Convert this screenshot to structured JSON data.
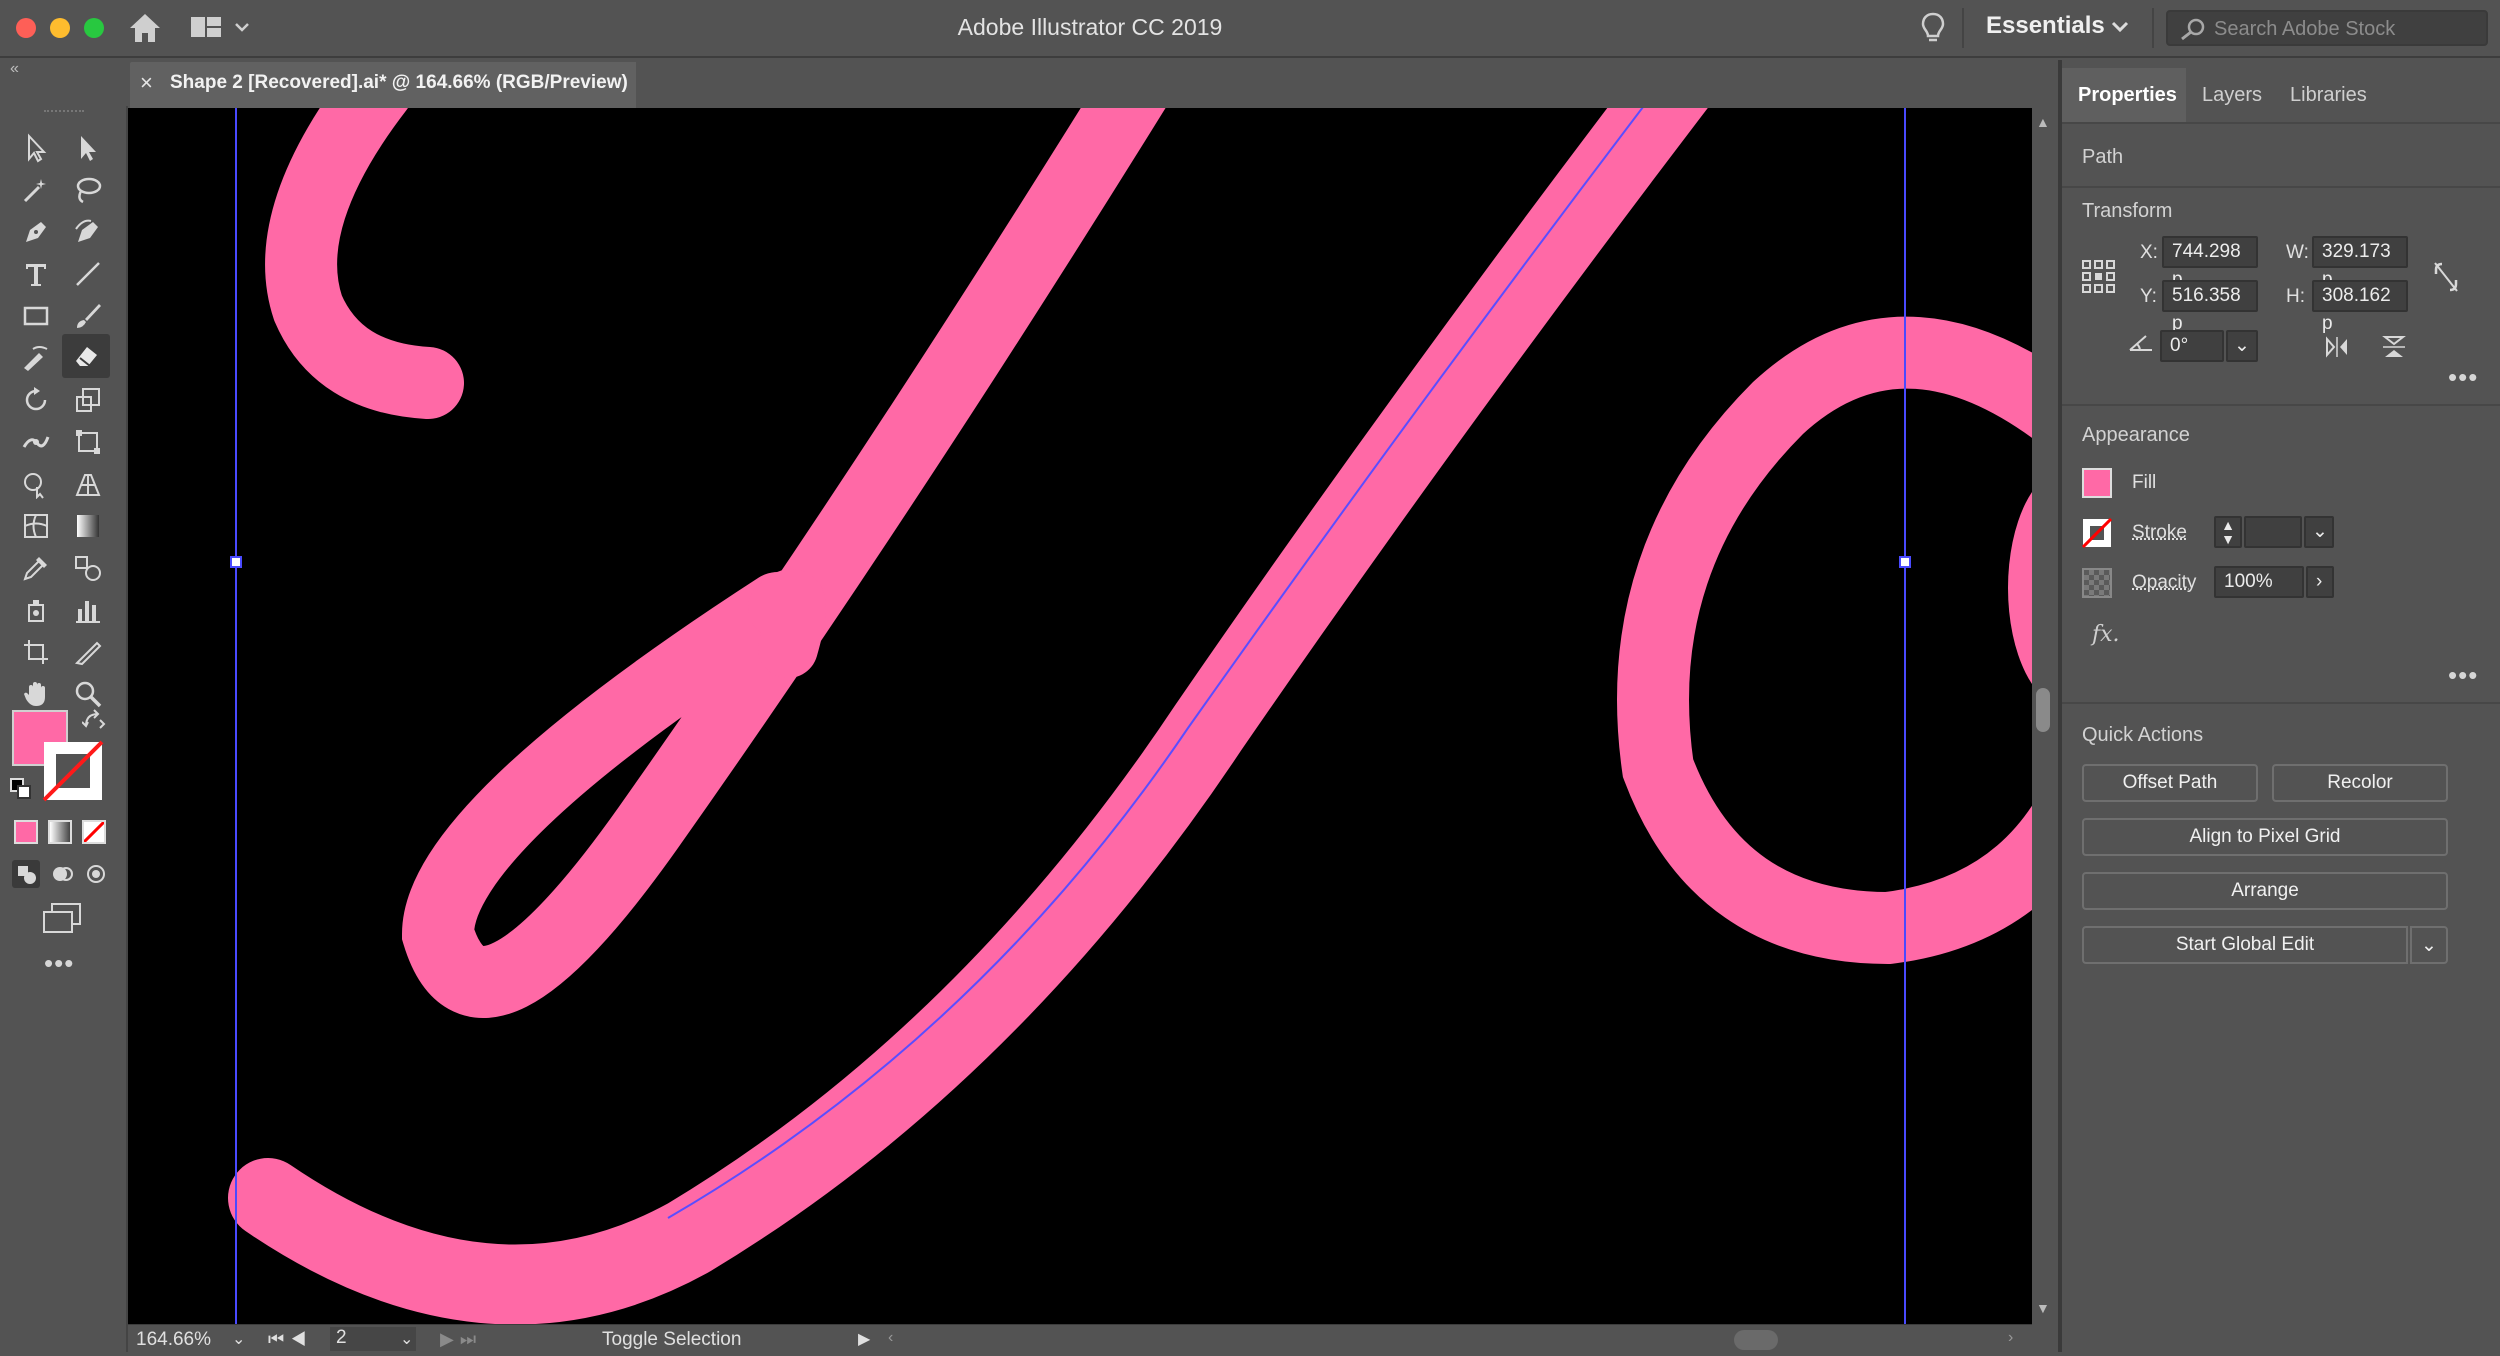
{
  "window": {
    "title": "Adobe Illustrator CC 2019",
    "workspace": "Essentials",
    "search_placeholder": "Search Adobe Stock"
  },
  "document_tab": {
    "label": "Shape 2 [Recovered].ai* @ 164.66% (RGB/Preview)",
    "close": "×"
  },
  "colors": {
    "fill": "#ff69a6",
    "canvas_bg": "#000000",
    "selection": "#4a4aff"
  },
  "panel": {
    "tabs": [
      "Properties",
      "Layers",
      "Libraries"
    ],
    "object_type": "Path",
    "transform": {
      "title": "Transform",
      "x_label": "X:",
      "x": "744.298 p",
      "y_label": "Y:",
      "y": "516.358 p",
      "w_label": "W:",
      "w": "329.173 p",
      "h_label": "H:",
      "h": "308.162 p",
      "angle": "0°"
    },
    "appearance": {
      "title": "Appearance",
      "fill_label": "Fill",
      "stroke_label": "Stroke",
      "opacity_label": "Opacity",
      "opacity": "100%",
      "fx": "fx."
    },
    "quick_actions": {
      "title": "Quick Actions",
      "offset_path": "Offset Path",
      "recolor": "Recolor",
      "align_pixel": "Align to Pixel Grid",
      "arrange": "Arrange",
      "global_edit": "Start Global Edit"
    },
    "more": "•••"
  },
  "status": {
    "zoom": "164.66%",
    "artboard": "2",
    "selection_label": "Toggle Selection"
  },
  "toolbar": {
    "more": "•••"
  }
}
